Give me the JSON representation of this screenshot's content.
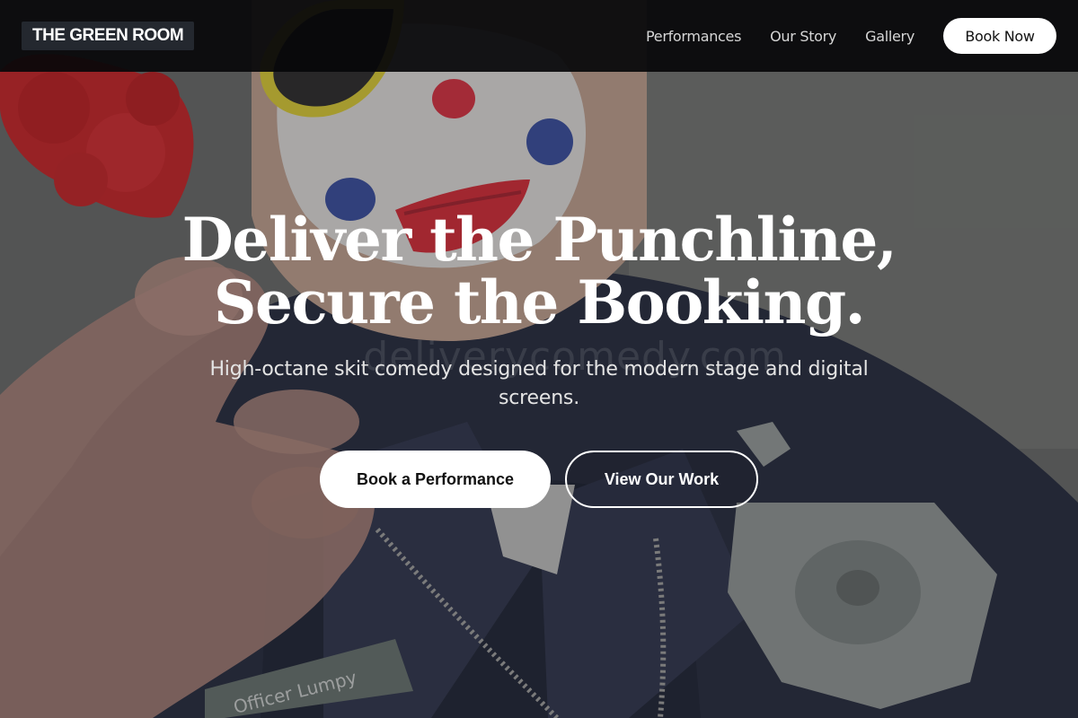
{
  "brand": {
    "name": "THE GREEN ROOM"
  },
  "nav": {
    "links": [
      {
        "label": "Performances"
      },
      {
        "label": "Our Story"
      },
      {
        "label": "Gallery"
      }
    ],
    "cta_label": "Book Now"
  },
  "hero": {
    "headline_line1": "Deliver the Punchline,",
    "headline_line2": "Secure the Booking.",
    "subheadline": "High-octane skit comedy designed for the modern stage and digital screens.",
    "primary_cta": "Book a Performance",
    "secondary_cta": "View Our Work",
    "background": {
      "nametag_text": "Officer Lumpy",
      "watermark_text": "deliverycomedy.com"
    }
  },
  "colors": {
    "nav_background": "#08080a",
    "button_background": "#ffffff",
    "button_text": "#111111",
    "headline": "#ffffff"
  }
}
